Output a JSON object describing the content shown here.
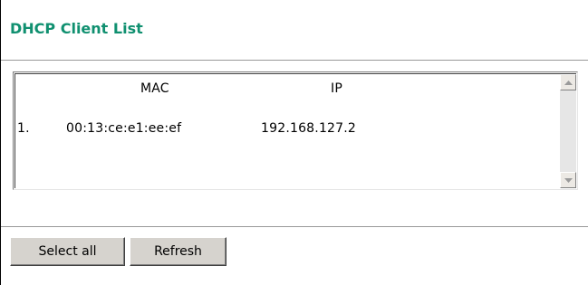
{
  "page": {
    "title": "DHCP Client List"
  },
  "client_list": {
    "columns": [
      "MAC",
      "IP"
    ],
    "rows": [
      {
        "index": "1.",
        "mac": "00:13:ce:e1:ee:ef",
        "ip": "192.168.127.2"
      }
    ]
  },
  "icons": {
    "scroll_up": "scroll-up-arrow",
    "scroll_down": "scroll-down-arrow"
  },
  "buttons": {
    "select_all": "Select all",
    "refresh": "Refresh"
  },
  "colors": {
    "title": "#109070",
    "button_face": "#d6d3ce",
    "divider": "#999999"
  }
}
